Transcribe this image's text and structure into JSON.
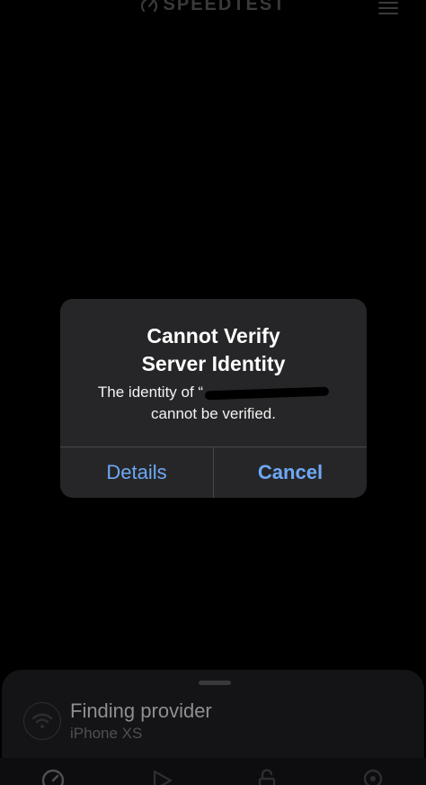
{
  "header": {
    "logo_text": "SPEEDTEST",
    "icons": {
      "logo": "gauge-logo-icon",
      "menu": "hamburger-menu-icon"
    }
  },
  "alert": {
    "title_line1": "Cannot Verify",
    "title_line2": "Server Identity",
    "message_prefix": "The identity of “",
    "message_line2": "cannot be verified.",
    "details_label": "Details",
    "cancel_label": "Cancel"
  },
  "sheet": {
    "title": "Finding provider",
    "device": "iPhone XS",
    "icons": {
      "wifi": "wifi-icon"
    }
  },
  "tabs": {
    "icons": [
      "speed-gauge-icon",
      "play-icon",
      "unlock-icon",
      "location-pin-icon"
    ]
  },
  "colors": {
    "background": "#000000",
    "alert_background": "#262628",
    "button_blue": "#6ea8f5",
    "divider": "#48484a",
    "muted_text": "#8e8e93"
  }
}
